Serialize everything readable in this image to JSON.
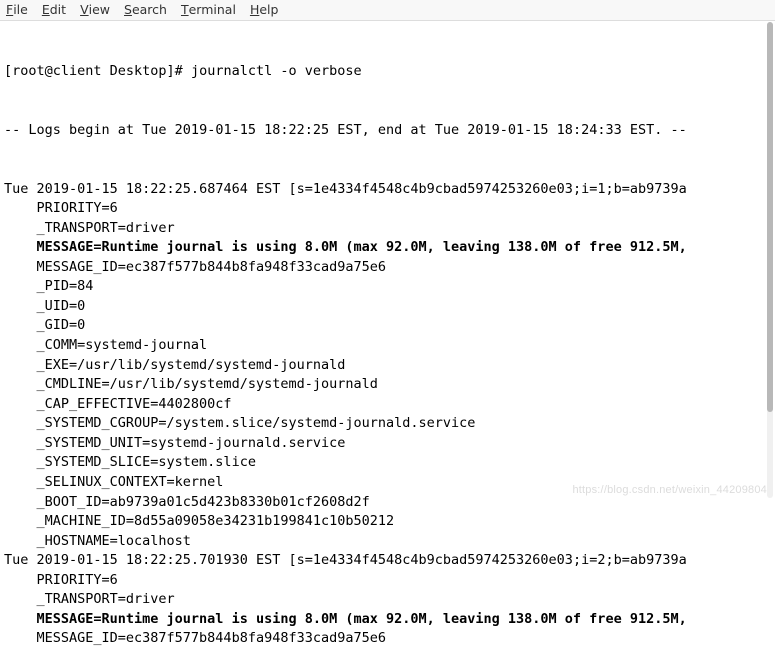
{
  "menubar": {
    "file": "File",
    "edit": "Edit",
    "view": "View",
    "search": "Search",
    "terminal": "Terminal",
    "help": "Help"
  },
  "prompt": "[root@client Desktop]# ",
  "command": "journalctl -o verbose",
  "header": "-- Logs begin at Tue 2019-01-15 18:22:25 EST, end at Tue 2019-01-15 18:24:33 EST. --",
  "entries": [
    {
      "ts": "Tue 2019-01-15 18:22:25.687464 EST [s=1e4334f4548c4b9cbad5974253260e03;i=1;b=ab9739a",
      "fields": [
        {
          "text": "PRIORITY=6",
          "bold": false
        },
        {
          "text": "_TRANSPORT=driver",
          "bold": false
        },
        {
          "text": "MESSAGE=Runtime journal is using 8.0M (max 92.0M, leaving 138.0M of free 912.5M,",
          "bold": true
        },
        {
          "text": "MESSAGE_ID=ec387f577b844b8fa948f33cad9a75e6",
          "bold": false
        },
        {
          "text": "_PID=84",
          "bold": false
        },
        {
          "text": "_UID=0",
          "bold": false
        },
        {
          "text": "_GID=0",
          "bold": false
        },
        {
          "text": "_COMM=systemd-journal",
          "bold": false
        },
        {
          "text": "_EXE=/usr/lib/systemd/systemd-journald",
          "bold": false
        },
        {
          "text": "_CMDLINE=/usr/lib/systemd/systemd-journald",
          "bold": false
        },
        {
          "text": "_CAP_EFFECTIVE=4402800cf",
          "bold": false
        },
        {
          "text": "_SYSTEMD_CGROUP=/system.slice/systemd-journald.service",
          "bold": false
        },
        {
          "text": "_SYSTEMD_UNIT=systemd-journald.service",
          "bold": false
        },
        {
          "text": "_SYSTEMD_SLICE=system.slice",
          "bold": false
        },
        {
          "text": "_SELINUX_CONTEXT=kernel",
          "bold": false
        },
        {
          "text": "_BOOT_ID=ab9739a01c5d423b8330b01cf2608d2f",
          "bold": false
        },
        {
          "text": "_MACHINE_ID=8d55a09058e34231b199841c10b50212",
          "bold": false
        },
        {
          "text": "_HOSTNAME=localhost",
          "bold": false
        }
      ]
    },
    {
      "ts": "Tue 2019-01-15 18:22:25.701930 EST [s=1e4334f4548c4b9cbad5974253260e03;i=2;b=ab9739a",
      "fields": [
        {
          "text": "PRIORITY=6",
          "bold": false
        },
        {
          "text": "_TRANSPORT=driver",
          "bold": false
        },
        {
          "text": "MESSAGE=Runtime journal is using 8.0M (max 92.0M, leaving 138.0M of free 912.5M,",
          "bold": true
        },
        {
          "text": "MESSAGE_ID=ec387f577b844b8fa948f33cad9a75e6",
          "bold": false
        }
      ]
    }
  ],
  "watermark": "https://blog.csdn.net/weixin_44209804"
}
